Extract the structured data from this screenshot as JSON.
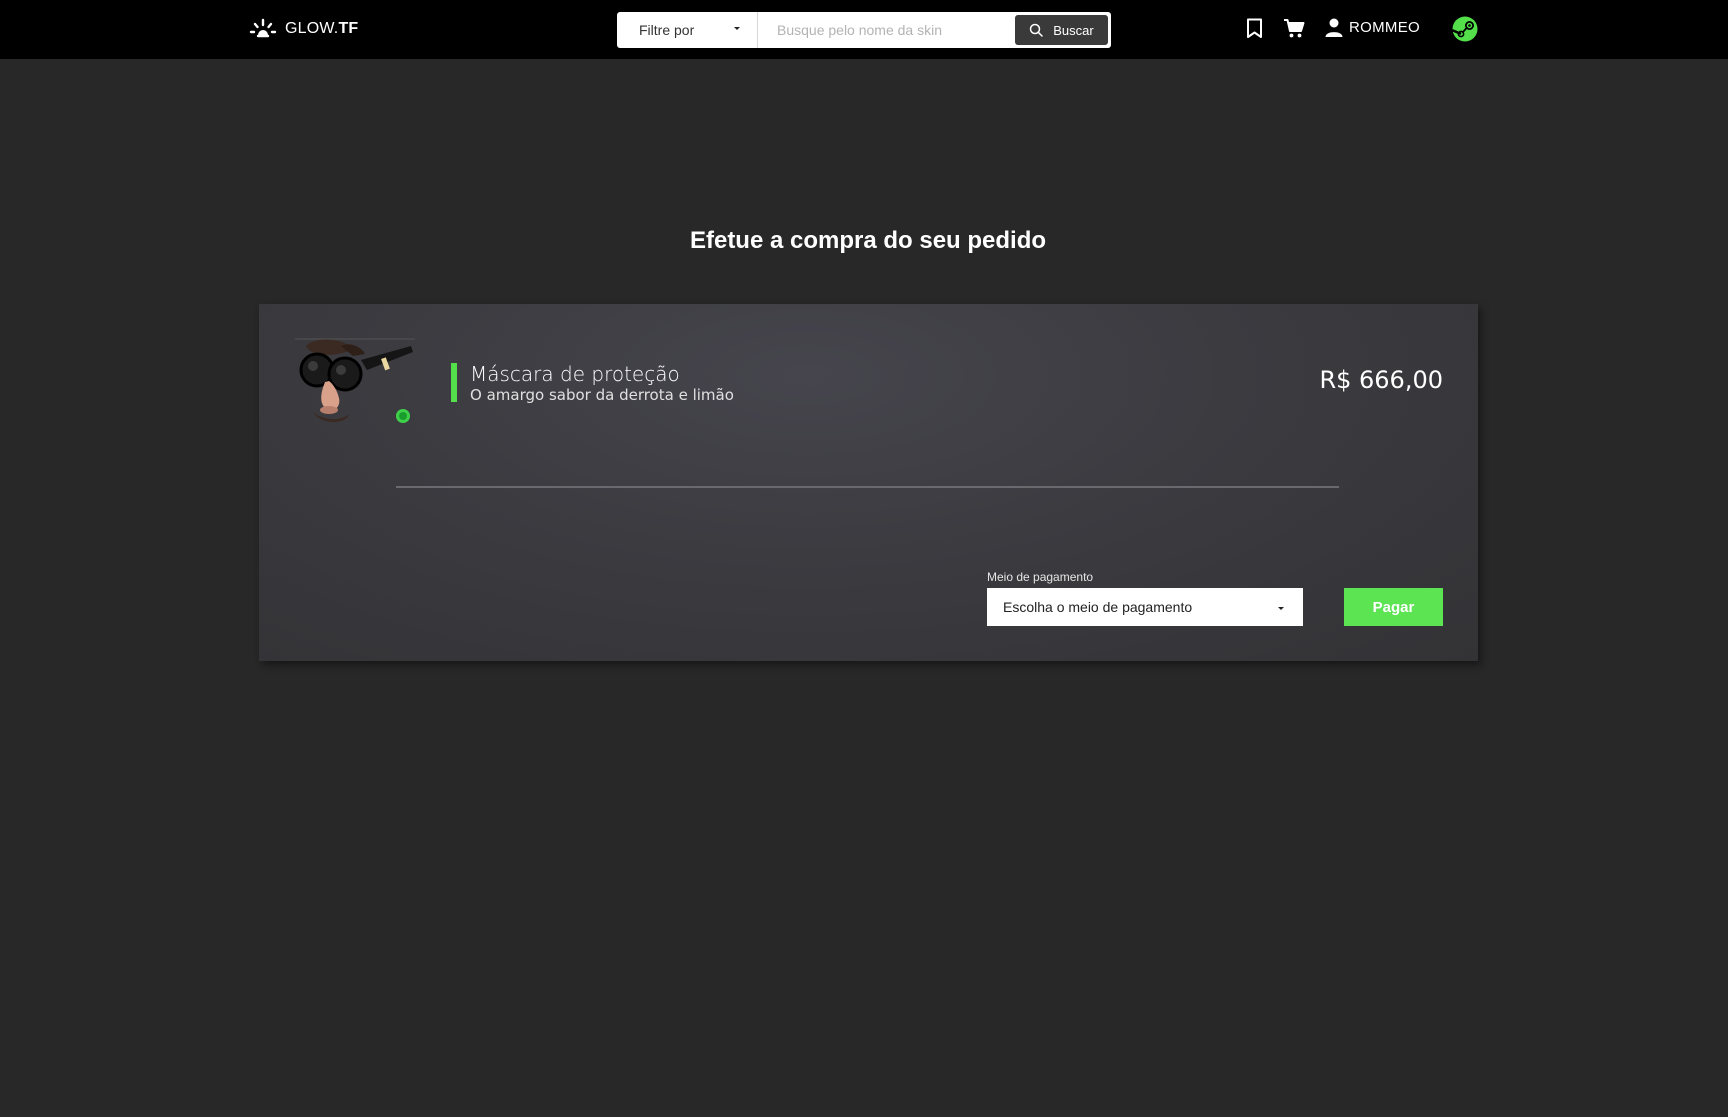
{
  "header": {
    "brand_prefix": "GLOW.",
    "brand_suffix": "TF",
    "filter_label": "Filtre por",
    "search_placeholder": "Busque pelo nome da skin",
    "search_button": "Buscar",
    "username": "ROMMEO",
    "icons": [
      "logo-icon",
      "bookmark-icon",
      "cart-icon",
      "user-icon",
      "steam-icon",
      "search-icon"
    ]
  },
  "main": {
    "title": "Efetue a compra do seu pedido",
    "item": {
      "name": "Máscara de proteção",
      "subtitle": "O amargo sabor da derrota e limão",
      "price": "R$ 666,00"
    },
    "payment": {
      "label": "Meio de pagamento",
      "select_value": "Escolha o meio de pagamento",
      "pay_button": "Pagar"
    }
  },
  "colors": {
    "accent_green": "#5ce453",
    "topbar": "#000000",
    "background": "#282828",
    "card": "#3b3b40"
  }
}
